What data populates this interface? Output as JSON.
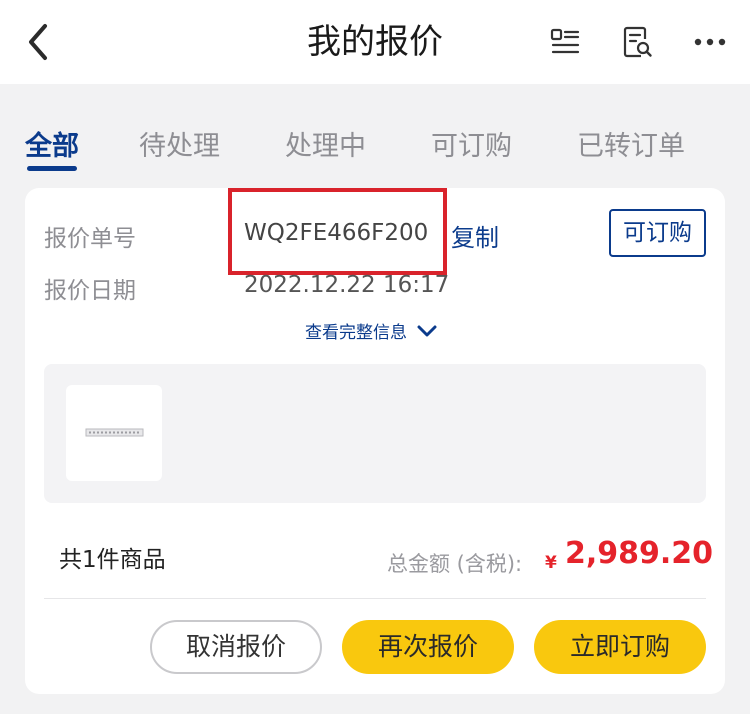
{
  "header": {
    "title": "我的报价",
    "back_icon": "chevron-left-icon",
    "actions": [
      "list-icon",
      "search-document-icon",
      "more-icon"
    ]
  },
  "tabs": [
    {
      "label": "全部",
      "active": true
    },
    {
      "label": "待处理",
      "active": false
    },
    {
      "label": "处理中",
      "active": false
    },
    {
      "label": "可订购",
      "active": false
    },
    {
      "label": "已转订单",
      "active": false
    }
  ],
  "quote": {
    "number_label": "报价单号",
    "number": "WQ2FE466F200",
    "copy_label": "复制",
    "date_label": "报价日期",
    "date": "2022.12.22 16:17",
    "status": "可订购",
    "expand_label": "查看完整信息",
    "item_count": "共1件商品",
    "total_label": "总金额 (含税):",
    "currency": "¥",
    "total_amount": "2,989.20"
  },
  "actions": {
    "cancel": "取消报价",
    "requote": "再次报价",
    "order": "立即订购"
  },
  "colors": {
    "accent": "#0b3b8c",
    "price": "#e5232b",
    "button_yellow": "#f9c80e",
    "highlight": "#d9232b"
  }
}
